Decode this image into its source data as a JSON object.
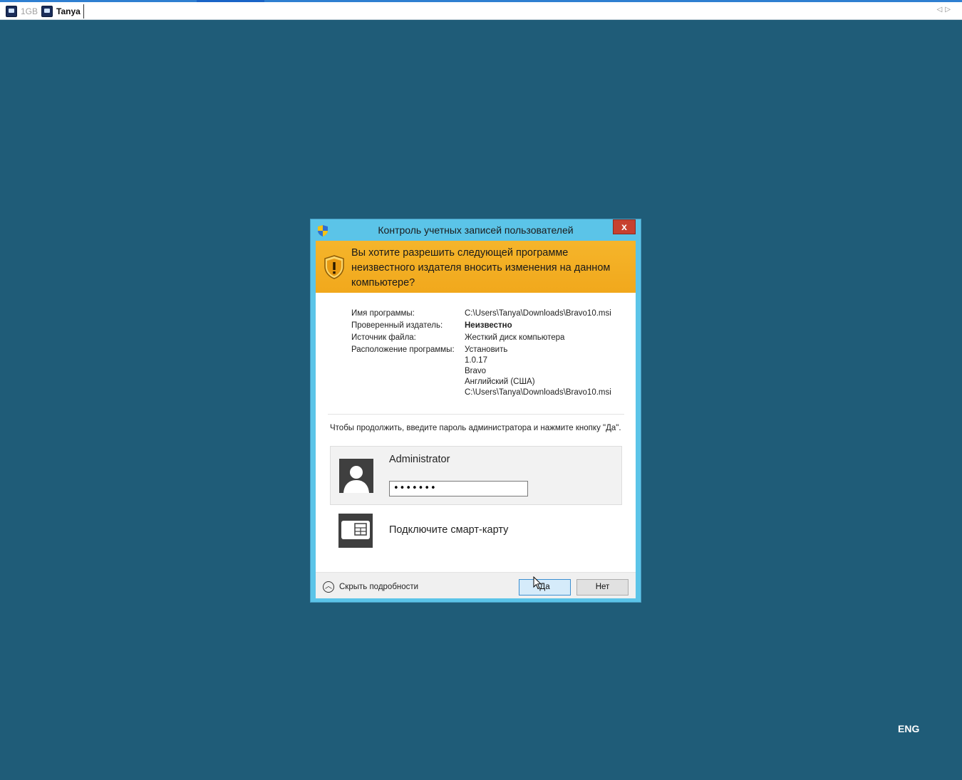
{
  "tabs": [
    {
      "label": "1GB",
      "icon": "rdp-icon"
    },
    {
      "label": "Tanya",
      "icon": "rdp-icon"
    }
  ],
  "dialog": {
    "title": "Контроль учетных записей пользователей",
    "close_label": "x",
    "warning": "Вы хотите разрешить следующей программе неизвестного издателя вносить изменения на данном компьютере?",
    "details": [
      {
        "label": "Имя программы:",
        "value": "C:\\Users\\Tanya\\Downloads\\Bravo10.msi"
      },
      {
        "label": "Проверенный издатель:",
        "value": "Неизвестно"
      },
      {
        "label": "Источник файла:",
        "value": "Жесткий диск компьютера"
      },
      {
        "label": "Расположение программы:",
        "value": "Установить"
      }
    ],
    "location_extra": [
      "1.0.17",
      "Bravo",
      "Английский (США)",
      "C:\\Users\\Tanya\\Downloads\\Bravo10.msi"
    ],
    "prompt": "Чтобы продолжить, введите пароль администратора и нажмите кнопку \"Да\".",
    "admin_name": "Administrator",
    "password_mask": "•••••••",
    "smartcard_label": "Подключите смарт-карту",
    "hide_details": "Скрыть подробности",
    "yes_label": "Да",
    "no_label": "Нет"
  },
  "language": "ENG",
  "colors": {
    "desktop": "#1f5c78",
    "dialog_frame": "#5bc4e8",
    "warning_banner": "#f5b52b",
    "close_button": "#c7412f"
  }
}
